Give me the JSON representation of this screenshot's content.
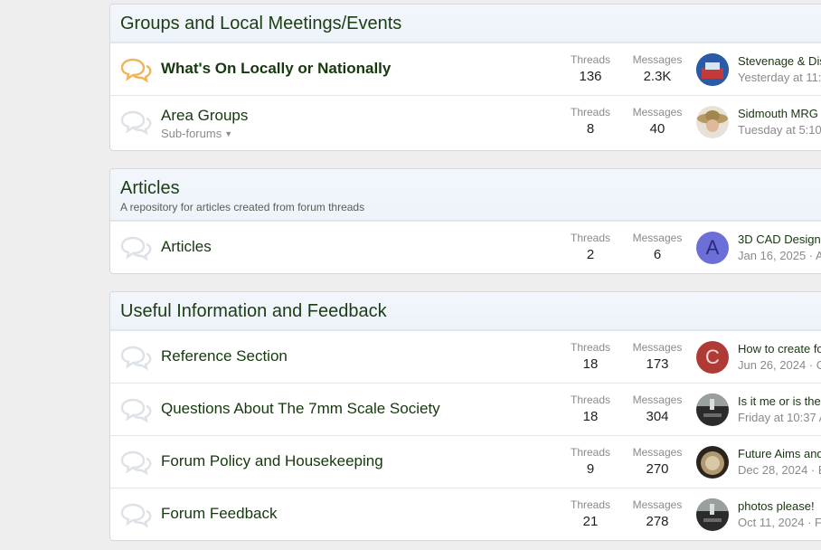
{
  "sections": [
    {
      "title": "Groups and Local Meetings/Events",
      "description": "",
      "nodes": [
        {
          "title": "What's On Locally or Nationally",
          "bold": true,
          "unread": true,
          "subforums": "",
          "threads_label": "Threads",
          "threads": "136",
          "messages_label": "Messages",
          "messages": "2.3K",
          "last_title": "Stevenage & Dis",
          "last_meta": "Yesterday at 11:",
          "avatar_letter": "",
          "avatar_color": "#2a5aa8"
        },
        {
          "title": "Area Groups",
          "bold": false,
          "unread": false,
          "subforums": "Sub-forums",
          "threads_label": "Threads",
          "threads": "8",
          "messages_label": "Messages",
          "messages": "40",
          "last_title": "Sidmouth MRG",
          "last_meta": "Tuesday at 5:10",
          "avatar_letter": "",
          "avatar_color": "#a68a55"
        }
      ]
    },
    {
      "title": "Articles",
      "description": "A repository for articles created from forum threads",
      "nodes": [
        {
          "title": "Articles",
          "bold": false,
          "unread": false,
          "subforums": "",
          "threads_label": "Threads",
          "threads": "2",
          "messages_label": "Messages",
          "messages": "6",
          "last_title": "3D CAD Design",
          "last_meta": "Jan 16, 2025 · A",
          "avatar_letter": "A",
          "avatar_color": "#6c6fd8"
        }
      ]
    },
    {
      "title": "Useful Information and Feedback",
      "description": "",
      "nodes": [
        {
          "title": "Reference Section",
          "bold": false,
          "unread": false,
          "subforums": "",
          "threads_label": "Threads",
          "threads": "18",
          "messages_label": "Messages",
          "messages": "173",
          "last_title": "How to create fo",
          "last_meta": "Jun 26, 2024 · C",
          "avatar_letter": "C",
          "avatar_color": "#b03b36"
        },
        {
          "title": "Questions About The 7mm Scale Society",
          "bold": false,
          "unread": false,
          "subforums": "",
          "threads_label": "Threads",
          "threads": "18",
          "messages_label": "Messages",
          "messages": "304",
          "last_title": "Is it me or is the",
          "last_meta": "Friday at 10:37 A",
          "avatar_letter": "",
          "avatar_color": "#2b2b2b"
        },
        {
          "title": "Forum Policy and Housekeeping",
          "bold": false,
          "unread": false,
          "subforums": "",
          "threads_label": "Threads",
          "threads": "9",
          "messages_label": "Messages",
          "messages": "270",
          "last_title": "Future Aims and",
          "last_meta": "Dec 28, 2024 · E",
          "avatar_letter": "",
          "avatar_color": "#4a3a2a"
        },
        {
          "title": "Forum Feedback",
          "bold": false,
          "unread": false,
          "subforums": "",
          "threads_label": "Threads",
          "threads": "21",
          "messages_label": "Messages",
          "messages": "278",
          "last_title": "photos please!",
          "last_meta": "Oct 11, 2024 · F",
          "avatar_letter": "",
          "avatar_color": "#2b2b2b"
        }
      ]
    }
  ]
}
